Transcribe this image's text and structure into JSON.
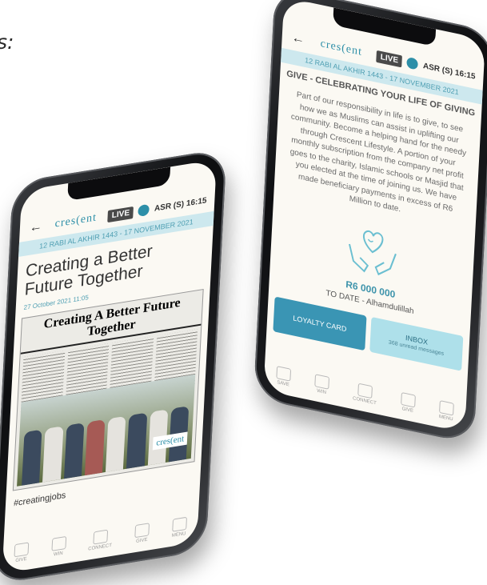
{
  "page_fragment": "s:",
  "left_phone": {
    "logo": "cres(ent",
    "live": "LIVE",
    "prayer_time": "ASR (S) 16:15",
    "hijri_date": "12 RABI AL AKHIR 1443 - 17 NOVEMBER 2021",
    "article_title": "Creating a Better Future Together",
    "article_date": "27 October 2021 11:05",
    "newspaper_headline": "Creating A Better Future Together",
    "photo_logo": "cres(ent",
    "hashtag": "#creatingjobs",
    "nav": [
      "GIVE",
      "WIN",
      "CONNECT",
      "GIVE",
      "MENU"
    ]
  },
  "right_phone": {
    "logo": "cres(ent",
    "live": "LIVE",
    "prayer_time": "ASR (S) 16:15",
    "hijri_date": "12 RABI AL AKHIR 1443 - 17 NOVEMBER 2021",
    "give_title": "GIVE - CELEBRATING YOUR LIFE OF GIVING",
    "give_body": "Part of our responsibility in life is to give, to see how we as Muslims can assist in uplifting our community. Become a helping hand for the needy through Crescent Lifestyle. A portion of your monthly subscription from the company net profit goes to the charity, Islamic schools or Masjid that you elected at the time of joining us. We have made beneficiary payments in excess of R6 Million to date.",
    "amount": "R6 000 000",
    "to_date": "TO DATE - Alhamdulillah",
    "loyalty_button": "LOYALTY CARD",
    "inbox_button": "INBOX",
    "inbox_sub": "368 unread messages",
    "nav": [
      "SAVE",
      "WIN",
      "CONNECT",
      "GIVE",
      "MENU"
    ]
  },
  "colors": {
    "accent": "#3a95b4",
    "date_bar": "#cde8ee",
    "screen_bg": "#fbf9f3"
  }
}
